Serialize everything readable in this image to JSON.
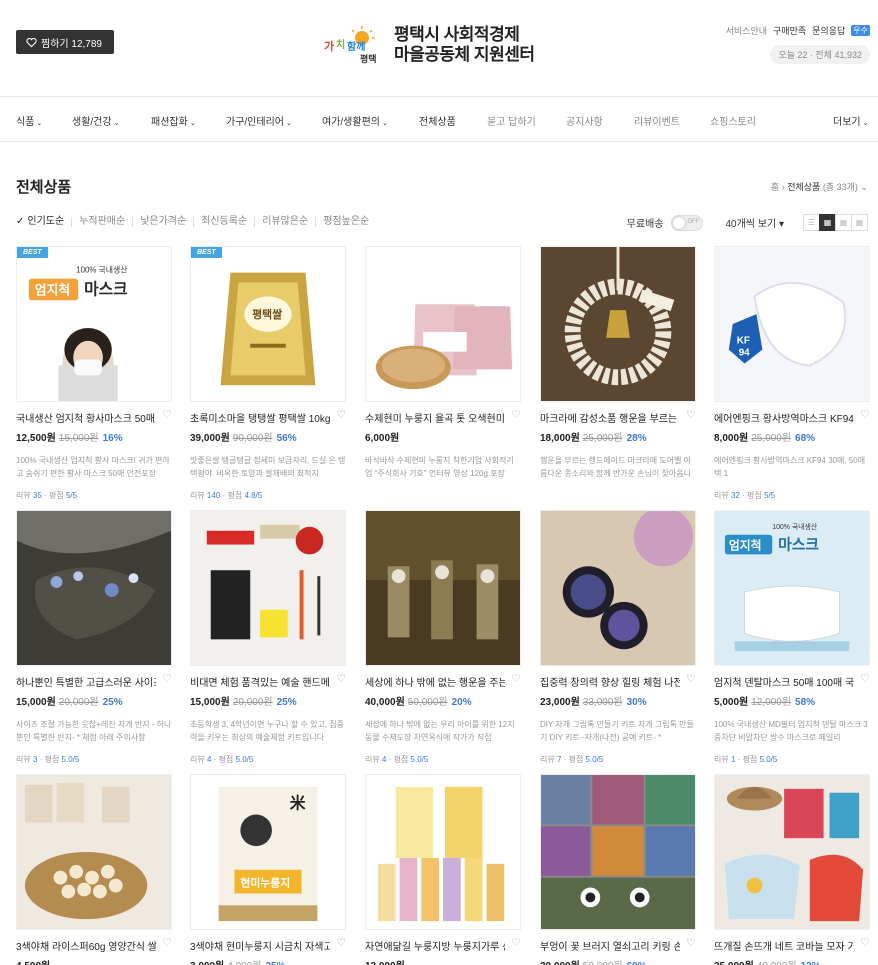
{
  "header": {
    "fav_label": "찜하기 12,789",
    "logo_line1": "평택시 사회적경제",
    "logo_line2": "마을공동체 지원센터",
    "logo_mark_text": "가치함께 평택",
    "links": [
      "서비스안내",
      "구매만족",
      "문의응답"
    ],
    "badge": "우수",
    "counter": "오늘 22 · 전체 41,932"
  },
  "nav": {
    "items": [
      {
        "label": "식품",
        "chev": true
      },
      {
        "label": "생활/건강",
        "chev": true
      },
      {
        "label": "패션잡화",
        "chev": true
      },
      {
        "label": "가구/인테리어",
        "chev": true
      },
      {
        "label": "여가/생활편의",
        "chev": true
      },
      {
        "label": "전체상품",
        "chev": false
      },
      {
        "label": "묻고 답하기",
        "chev": false
      },
      {
        "label": "공지사항",
        "chev": false
      },
      {
        "label": "리뷰이벤트",
        "chev": false
      },
      {
        "label": "쇼핑스토리",
        "chev": false
      }
    ],
    "more": "더보기"
  },
  "page": {
    "title": "전체상품",
    "breadcrumb_home": "홈",
    "breadcrumb_current": "전체상품",
    "breadcrumb_count": "(총 33개)"
  },
  "sort": {
    "options": [
      "인기도순",
      "누적판매순",
      "낮은가격순",
      "최신등록순",
      "리뷰많은순",
      "평점높은순"
    ],
    "free_shipping": "무료배송",
    "toggle_text": "OFF",
    "per_page": "40개씩 보기"
  },
  "products": [
    {
      "name": "국내생산 엄지척 황사마스크 50매 KF80",
      "price": "12,500원",
      "orig": "15,000원",
      "disc": "16%",
      "best": true,
      "desc": "100% 국내생산 엄지척 황사 마스크! 귀가 편하고 숨쉬기 편한 황사 마스크 50매 안전포장",
      "reviews": "35",
      "rating": "5/5",
      "thumb_text": "엄지척 마스크",
      "thumb_sub": "100% 국내생산",
      "thumb_tag": "KF80 MASK"
    },
    {
      "name": "초록미소마을 탱탱쌀 평택쌀 10kg 2022년산",
      "price": "39,000원",
      "orig": "90,000원",
      "disc": "56%",
      "best": true,
      "desc": "맛좋은쌀 탱글탱글 청세미 보금자리, 드실 은 탱택평야. 비옥한 토양과 쌀재배의 최적지",
      "reviews": "140",
      "rating": "4.8/5",
      "thumb_text": "평택쌀"
    },
    {
      "name": "수제현미 누룽지 율곡 톳 오색현미 120g",
      "price": "6,000원",
      "orig": "",
      "disc": "",
      "best": false,
      "desc": "바삭바삭 수제현미 누룽지 착한기업 사회적기업 \"주식회사 기호\" 언터뷰 영상 120g 포장",
      "reviews": "",
      "rating": "",
      "thumb_text": "누룽지"
    },
    {
      "name": "마크라메 감성소품 행운을 부르는 종",
      "price": "18,000원",
      "orig": "25,000원",
      "disc": "28%",
      "best": false,
      "desc": "행운을 부르는 핸드메이드 마크라메 도어벨 아름다운 종소리와 함께 반가운 손님이 찾아옵니다",
      "reviews": "",
      "rating": "",
      "thumb_text": ""
    },
    {
      "name": "에어엔핑크 황사방역마스크 KF94 30매",
      "price": "8,000원",
      "orig": "25,000원",
      "disc": "68%",
      "best": false,
      "desc": "에어엔핑크 황사방역마스크 KF94 30매, 50매 택 1",
      "reviews": "32",
      "rating": "5/5",
      "thumb_text": "KF 94"
    },
    {
      "name": "하나뿐인 특별한 고급스러운 사이즈 조절 반지",
      "price": "15,000원",
      "orig": "20,000원",
      "disc": "25%",
      "best": false,
      "desc": "사이즈 조절 가능한 웃찮+레진 자개 반지 - 하나뿐인 특별한 반지- * 체험 아래 주의사항",
      "reviews": "3",
      "rating": "5.0/5",
      "thumb_text": ""
    },
    {
      "name": "비대면 체험 품격있는 예술 핸드메이드 도장",
      "price": "15,000원",
      "orig": "20,000원",
      "disc": "25%",
      "best": false,
      "desc": "초등학생 3, 4학년이면 누구나 할 수 있고, 집중력을 키우는 최상의 예술체험 키트입니다",
      "reviews": "4",
      "rating": "5.0/5",
      "thumb_text": ""
    },
    {
      "name": "세상에 하나 밖에 없는 행운을 주는 도장",
      "price": "40,000원",
      "orig": "50,000원",
      "disc": "20%",
      "best": false,
      "desc": "세상에 하나 밖에 없는 우리 아이를 위한 12지 동물 수제도장 자연옥식에 작가가 직접",
      "reviews": "4",
      "rating": "5.0/5",
      "thumb_text": ""
    },
    {
      "name": "집중력 창의력 향상 힐링 체험 나전칠기 자개",
      "price": "23,000원",
      "orig": "33,000원",
      "disc": "30%",
      "best": false,
      "desc": "DIY 자개 그립톡 만들기 키트 자개 그립톡 만들기 DIY 키트 -자개(나전) 공예 키트- *",
      "reviews": "7",
      "rating": "5.0/5",
      "thumb_text": ""
    },
    {
      "name": "엄지척 덴탈마스크 50매 100매 국내생산",
      "price": "5,000원",
      "orig": "12,000원",
      "disc": "58%",
      "best": false,
      "desc": "100% 국내생산 MD필터 엄지척 덴탈 마스크 3중차단 비말차단 방수 마스크로 페일리",
      "reviews": "1",
      "rating": "5.0/5",
      "thumb_text": "엄지척 마스크",
      "thumb_sub": "100% 국내생산",
      "thumb_tag": "KF-AD MASK"
    },
    {
      "name": "3색야채 라이스퍼60g 영양간식 쌀과자",
      "price": "4,500원",
      "orig": "",
      "disc": "",
      "best": false,
      "desc": "",
      "reviews": "",
      "rating": "",
      "thumb_text": ""
    },
    {
      "name": "3색야채 현미누룽지 시금치 자색고구마 당근",
      "price": "3,000원",
      "orig": "4,000원",
      "disc": "25%",
      "best": false,
      "desc": "",
      "reviews": "",
      "rating": "",
      "thumb_text": "현미누룽지",
      "thumb_sub": "米"
    },
    {
      "name": "자연애닮길 누룽지방 누룽지가루 선물세트",
      "price": "12,000원",
      "orig": "",
      "disc": "",
      "best": false,
      "desc": "",
      "reviews": "",
      "rating": "",
      "thumb_text": ""
    },
    {
      "name": "부엉이 꽃 브러지 열쇠고리 키링 손뜨개",
      "price": "20,000원",
      "orig": "50,000원",
      "disc": "60%",
      "best": false,
      "desc": "",
      "reviews": "",
      "rating": "",
      "thumb_text": ""
    },
    {
      "name": "뜨개질 손뜨개 네트 코바늘 모자 가방 세트",
      "price": "35,000원",
      "orig": "40,000원",
      "disc": "12%",
      "best": false,
      "desc": "",
      "reviews": "",
      "rating": "",
      "thumb_text": ""
    }
  ],
  "labels": {
    "review": "리뷰",
    "rating": "평점",
    "sep": "·"
  },
  "colors": {
    "accent": "#3f7ad6",
    "best": "#44a3e0",
    "fav_btn": "#333333"
  }
}
